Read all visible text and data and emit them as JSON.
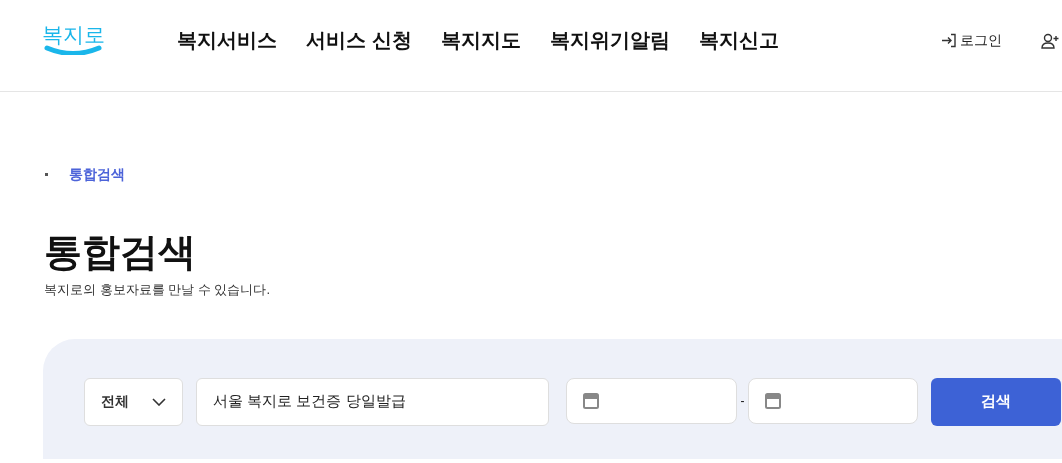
{
  "logo": {
    "text": "복지로"
  },
  "nav": [
    {
      "label": "복지서비스"
    },
    {
      "label": "서비스 신청"
    },
    {
      "label": "복지지도"
    },
    {
      "label": "복지위기알림"
    },
    {
      "label": "복지신고"
    }
  ],
  "login": {
    "label": "로그인"
  },
  "breadcrumb": [
    "통합검색"
  ],
  "page_title": "통합검색",
  "subtitle": "복지로의 홍보자료를 만날 수 있습니다.",
  "search": {
    "category": "전체",
    "query": "서울 복지로 보건증 당일발급",
    "date_separator": "-",
    "button": "검색"
  }
}
